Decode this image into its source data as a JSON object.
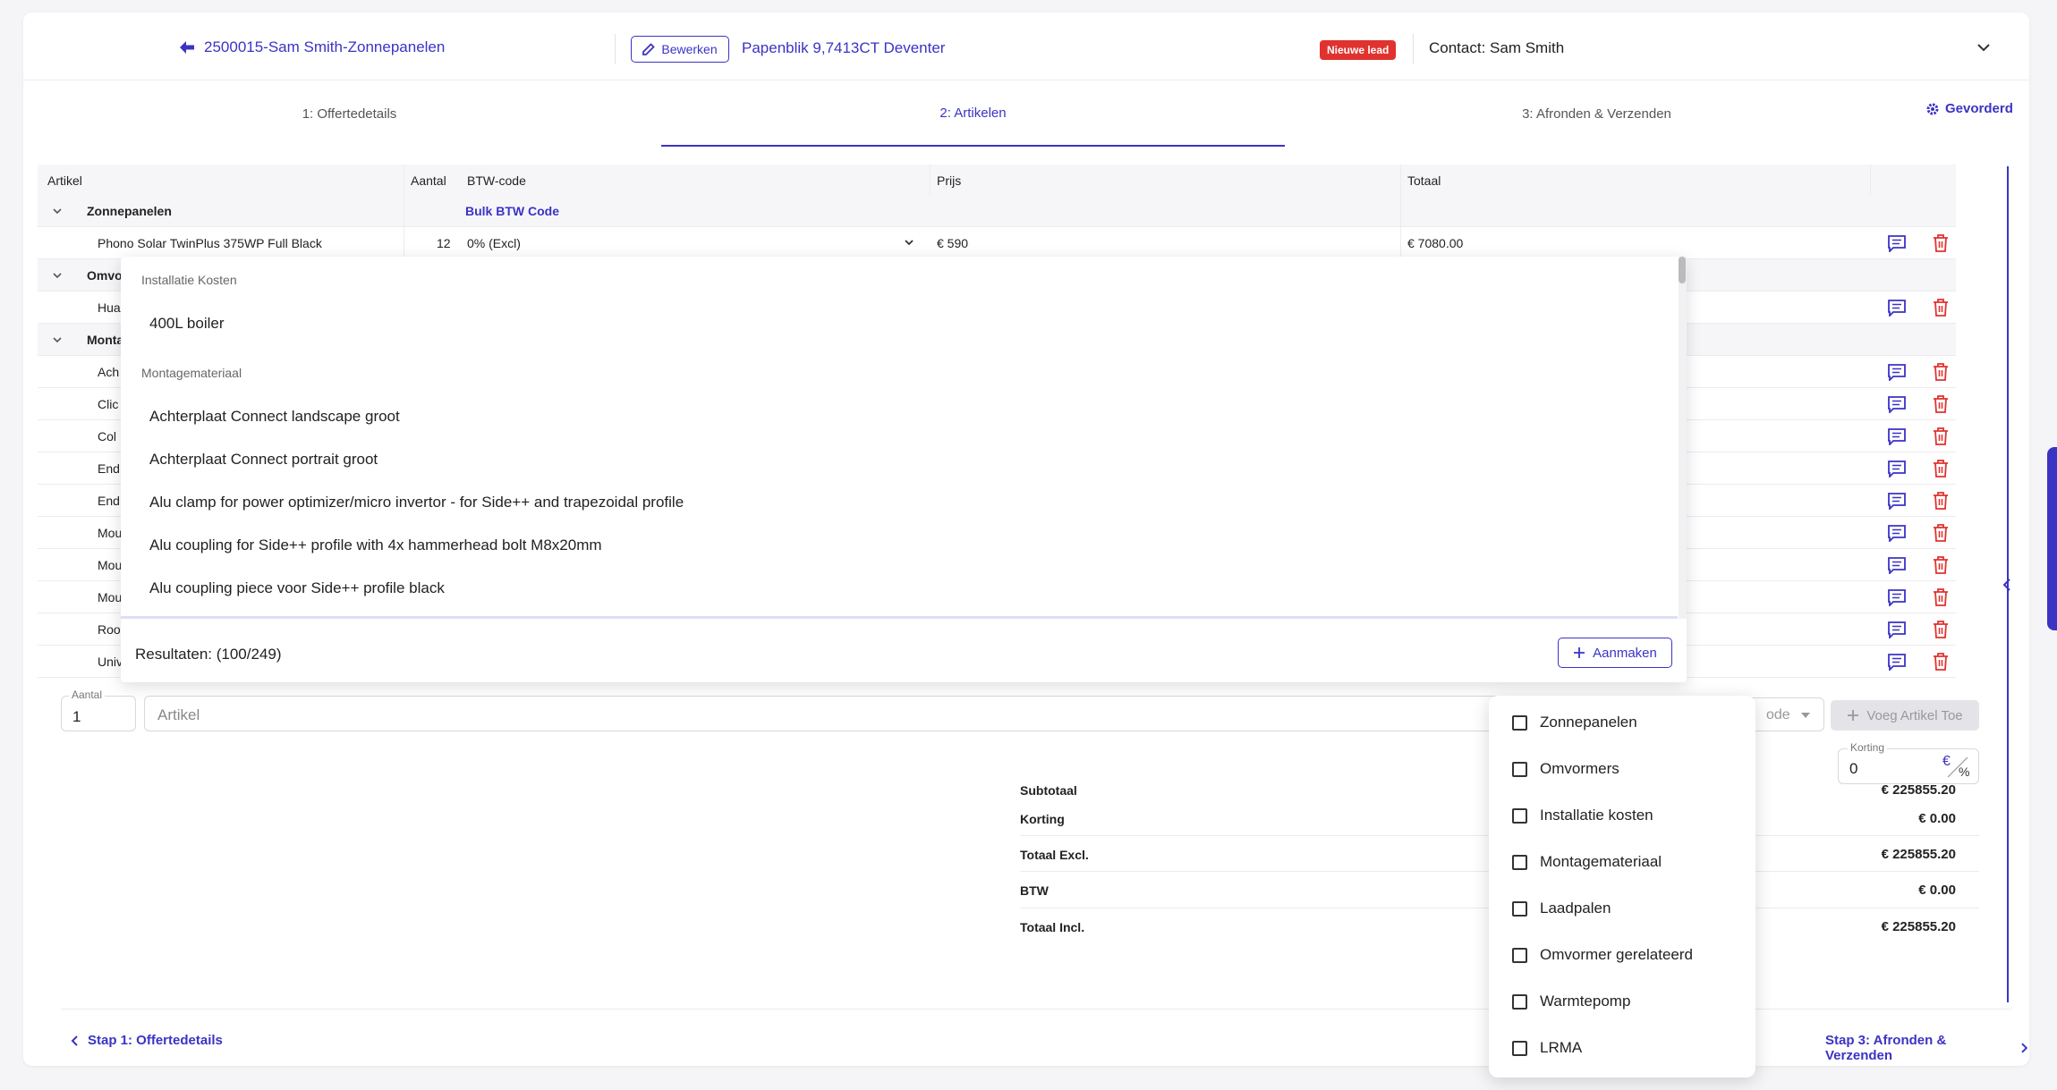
{
  "header": {
    "back_title": "2500015-Sam Smith-Zonnepanelen",
    "edit_label": "Bewerken",
    "address": "Papenblik 9,7413CT Deventer",
    "lead_badge": "Nieuwe lead",
    "contact": "Contact: Sam Smith"
  },
  "tabs": [
    {
      "label": "1: Offertedetails"
    },
    {
      "label": "2: Artikelen"
    },
    {
      "label": "3: Afronden & Verzenden"
    }
  ],
  "ordered_label": "Gevorderd",
  "table": {
    "columns": [
      "Artikel",
      "Aantal",
      "BTW-code",
      "Prijs",
      "Totaal"
    ],
    "group1": {
      "name": "Zonnepanelen",
      "bulk_label": "Bulk BTW Code"
    },
    "row1": {
      "artikel": "Phono Solar TwinPlus 375WP Full Black",
      "aantal": "12",
      "btw": "0% (Excl)",
      "prijs": "€ 590",
      "totaal": "€ 7080.00"
    },
    "group2": {
      "name": "Omvo"
    },
    "row2": {
      "artikel": "Hua"
    },
    "group3": {
      "name": "Monta"
    },
    "rows": [
      {
        "artikel": "Ach"
      },
      {
        "artikel": "Clic"
      },
      {
        "artikel": "Col"
      },
      {
        "artikel": "End"
      },
      {
        "artikel": "End"
      },
      {
        "artikel": "Mou"
      },
      {
        "artikel": "Mou"
      },
      {
        "artikel": "Mou"
      },
      {
        "artikel": "Roo"
      },
      {
        "artikel": "Univ"
      }
    ]
  },
  "dropdown": {
    "group_a": "Installatie Kosten",
    "item_a1": "400L boiler",
    "group_b": "Montagemateriaal",
    "items_b": [
      "Achterplaat Connect landscape groot",
      "Achterplaat Connect portrait groot",
      "Alu clamp for power optimizer/micro invertor - for Side++ and trapezoidal profile",
      "Alu coupling for Side++ profile with 4x hammerhead bolt M8x20mm",
      "Alu coupling piece voor Side++ profile black"
    ],
    "results": "Resultaten: (100/249)",
    "create_label": "Aanmaken"
  },
  "add_row": {
    "qty_label": "Aantal",
    "qty_value": "1",
    "artikel_placeholder": "Artikel",
    "btw_placeholder": "ode",
    "add_label": "Voeg Artikel Toe"
  },
  "korting": {
    "label": "Korting",
    "value": "0",
    "euro": "€",
    "pct": "%"
  },
  "totals": [
    {
      "label": "Subtotaal",
      "value": "€ 225855.20"
    },
    {
      "label": "Korting",
      "value": "€ 0.00"
    },
    {
      "label": "Totaal Excl.",
      "value": "€ 225855.20"
    },
    {
      "label": "BTW",
      "value": "€ 0.00"
    },
    {
      "label": "Totaal Incl.",
      "value": "€ 225855.20"
    }
  ],
  "footer": {
    "prev": "Stap 1: Offertedetails",
    "next": "Stap 3: Afronden & Verzenden"
  },
  "categories": [
    "Zonnepanelen",
    "Omvormers",
    "Installatie kosten",
    "Montagemateriaal",
    "Laadpalen",
    "Omvormer gerelateerd",
    "Warmtepomp",
    "LRMA"
  ],
  "colors": {
    "accent": "#3b33c4",
    "danger": "#e0322f"
  }
}
